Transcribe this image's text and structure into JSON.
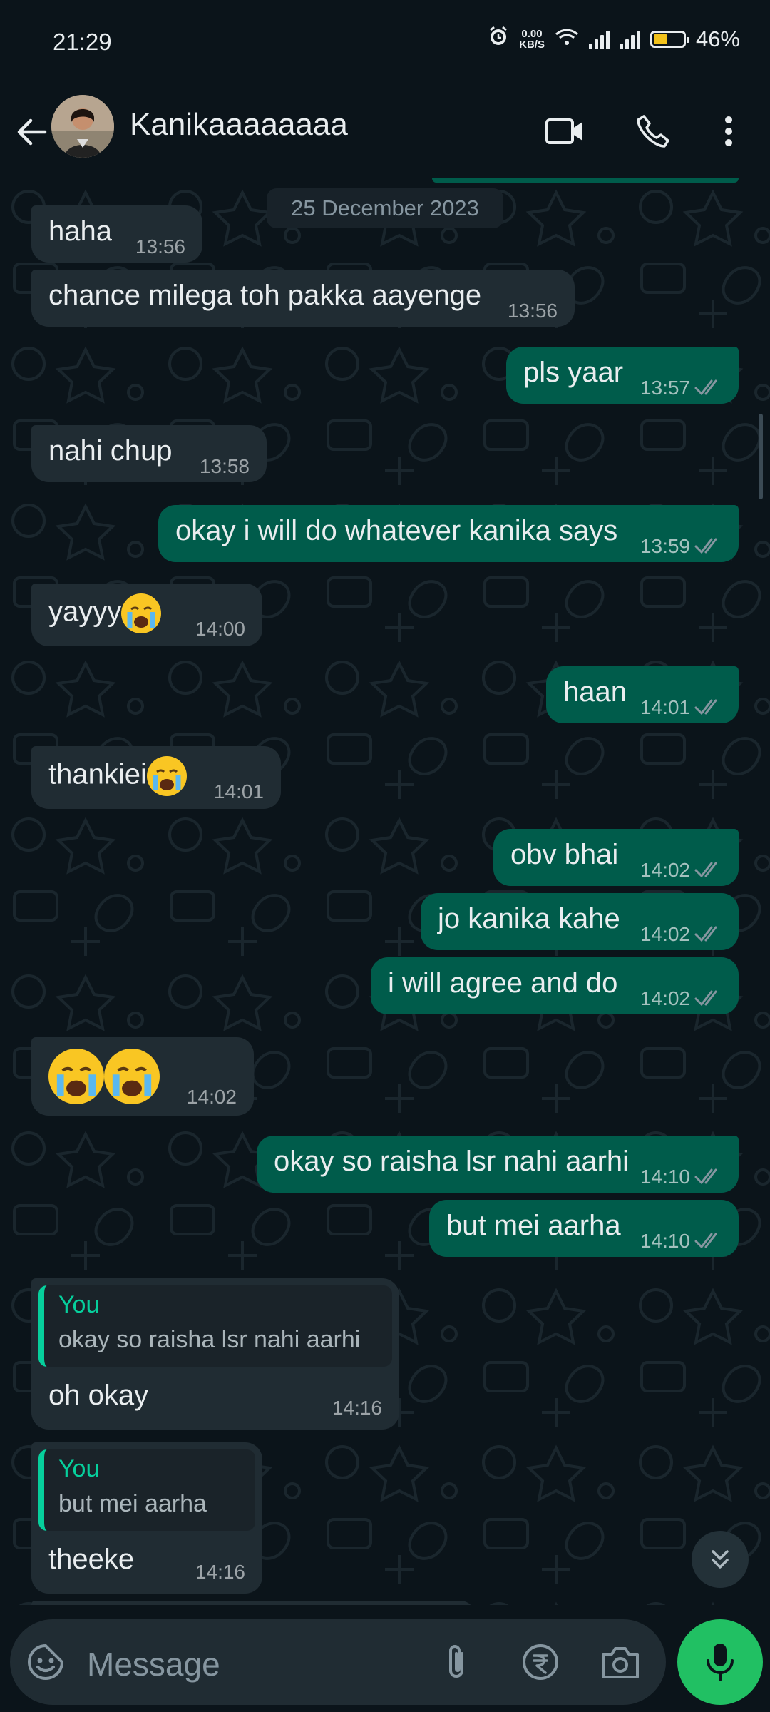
{
  "status_bar": {
    "time": "21:29",
    "net_speed_value": "0.00",
    "net_speed_unit": "KB/S",
    "battery_percent": "46%",
    "battery_level": 0.46,
    "icons": [
      "alarm-icon",
      "wifi-icon",
      "signal-icon",
      "signal-icon",
      "battery-icon"
    ]
  },
  "header": {
    "contact_name": "Kanikaaaaaaaa",
    "icons": [
      "back-arrow-icon",
      "avatar",
      "video-call-icon",
      "voice-call-icon",
      "more-options-icon"
    ]
  },
  "chat": {
    "date_chip": "25 December 2023",
    "messages": [
      {
        "dir": "in",
        "text": "haha",
        "time": "13:56"
      },
      {
        "dir": "in",
        "text": "chance milega toh pakka aayenge",
        "time": "13:56"
      },
      {
        "dir": "out",
        "text": "pls yaar",
        "time": "13:57",
        "status": "read"
      },
      {
        "dir": "in",
        "text": "nahi chup",
        "time": "13:58"
      },
      {
        "dir": "out",
        "text": "okay i will do whatever kanika says",
        "time": "13:59",
        "status": "read"
      },
      {
        "dir": "in",
        "text": "yayyy",
        "emoji": "loudly-crying-face",
        "time": "14:00"
      },
      {
        "dir": "out",
        "text": "haan",
        "time": "14:01",
        "status": "read"
      },
      {
        "dir": "in",
        "text": "thankiei",
        "emoji": "loudly-crying-face",
        "time": "14:01"
      },
      {
        "dir": "out",
        "text": "obv bhai",
        "time": "14:02",
        "status": "read"
      },
      {
        "dir": "out",
        "text": "jo kanika kahe",
        "time": "14:02",
        "status": "read"
      },
      {
        "dir": "out",
        "text": "i will agree and do",
        "time": "14:02",
        "status": "read"
      },
      {
        "dir": "in",
        "text": "",
        "emoji": "loudly-crying-face x2",
        "time": "14:02"
      },
      {
        "dir": "out",
        "text": "okay so raisha lsr nahi aarhi",
        "time": "14:10",
        "status": "read"
      },
      {
        "dir": "out",
        "text": "but mei aarha",
        "time": "14:10",
        "status": "read"
      },
      {
        "dir": "in",
        "quote_author": "You",
        "quote_text": "okay so raisha lsr nahi aarhi",
        "text": "oh okay",
        "time": "14:16"
      },
      {
        "dir": "in",
        "quote_author": "You",
        "quote_text": "but mei aarha",
        "text": "theeke",
        "time": "14:16"
      }
    ]
  },
  "input": {
    "placeholder": "Message",
    "icons": [
      "sticker-icon",
      "attach-icon",
      "rupee-payment-icon",
      "camera-icon",
      "mic-icon",
      "scroll-down-icon"
    ]
  },
  "colors": {
    "background": "#0b141a",
    "incoming_bubble": "#202c33",
    "outgoing_bubble": "#005c4b",
    "accent_green": "#21c063",
    "quote_accent": "#06cf9c",
    "read_ticks": "#8696a0"
  }
}
